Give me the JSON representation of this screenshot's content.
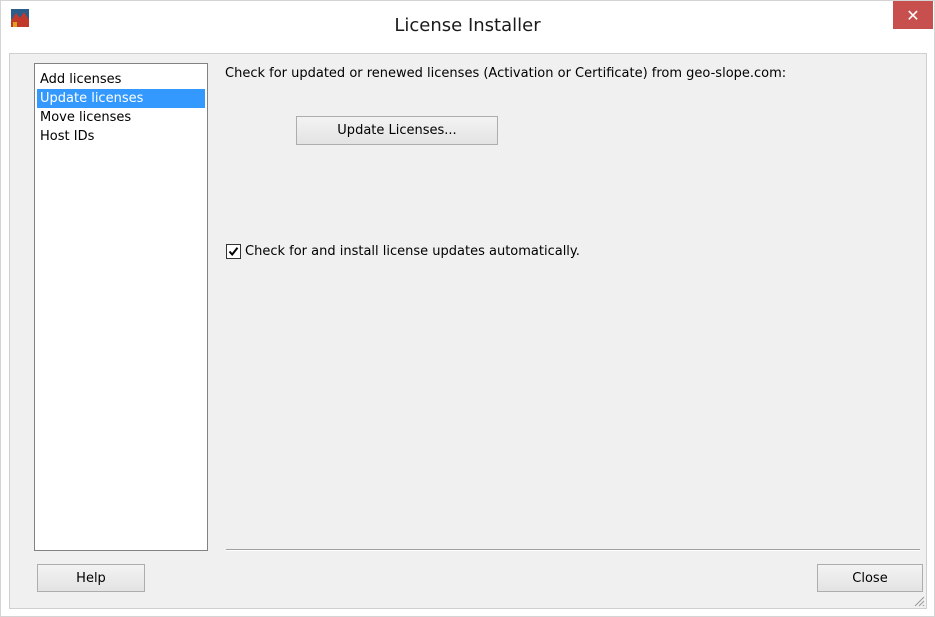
{
  "window": {
    "title": "License Installer",
    "close_glyph": "✕",
    "app_icon": "application-icon"
  },
  "sidebar": {
    "items": [
      {
        "label": "Add licenses",
        "selected": false
      },
      {
        "label": "Update licenses",
        "selected": true
      },
      {
        "label": "Move licenses",
        "selected": false
      },
      {
        "label": "Host IDs",
        "selected": false
      }
    ]
  },
  "main": {
    "description": "Check for updated or renewed licenses (Activation or Certificate) from geo-slope.com:",
    "update_button_label": "Update Licenses...",
    "auto_update_checkbox": {
      "label": "Check for and install license updates automatically.",
      "checked": true
    }
  },
  "footer": {
    "help_label": "Help",
    "close_label": "Close"
  },
  "colors": {
    "selection": "#3399ff",
    "close_button": "#c7504f",
    "dialog_background": "#f0f0f0"
  }
}
